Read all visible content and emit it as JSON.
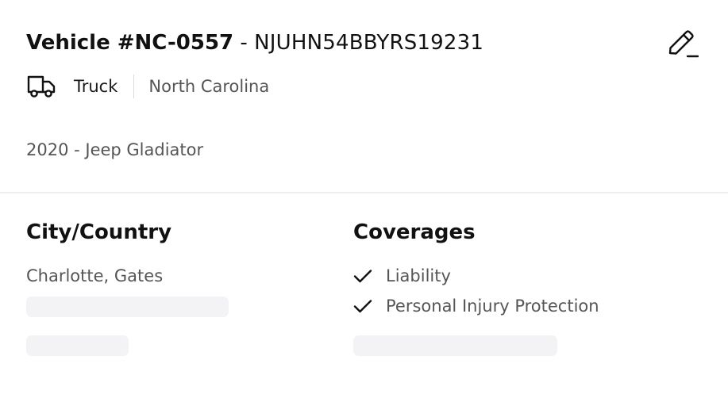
{
  "vehicle": {
    "id_label": "Vehicle #NC-0557",
    "separator": " - ",
    "vin": "NJUHN54BBYRS19231",
    "type": "Truck",
    "state": "North Carolina",
    "model": "2020 - Jeep Gladiator"
  },
  "icons": {
    "edit": "pencil-edit-icon",
    "vehicle_type": "truck-icon",
    "coverage_check": "checkmark-icon"
  },
  "location": {
    "title": "City/Country",
    "value": "Charlotte, Gates"
  },
  "coverages": {
    "title": "Coverages",
    "items": [
      {
        "label": "Liability"
      },
      {
        "label": "Personal Injury Protection"
      }
    ]
  },
  "colors": {
    "primary_text": "#111111",
    "secondary_text": "#555555",
    "skeleton": "#f3f2f5",
    "divider": "#efefef"
  }
}
